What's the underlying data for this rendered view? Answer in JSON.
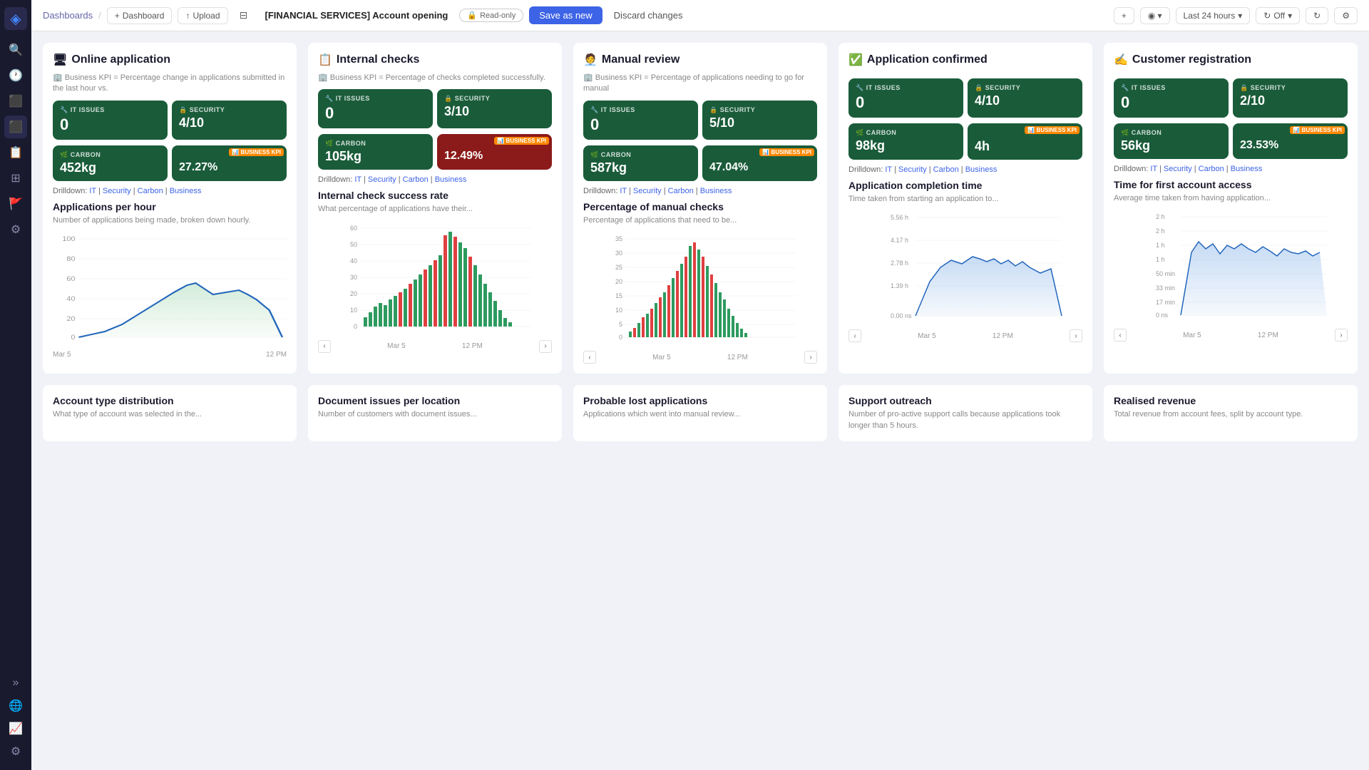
{
  "sidebar": {
    "icons": [
      {
        "name": "logo-icon",
        "symbol": "◈"
      },
      {
        "name": "search-icon",
        "symbol": "🔍"
      },
      {
        "name": "recent-icon",
        "symbol": "🕐"
      },
      {
        "name": "apps-icon",
        "symbol": "⬛"
      },
      {
        "name": "layers-icon",
        "symbol": "📊"
      },
      {
        "name": "panel-icon",
        "symbol": "📋"
      },
      {
        "name": "grid-icon",
        "symbol": "⊞"
      },
      {
        "name": "flag-icon",
        "symbol": "🚩"
      },
      {
        "name": "code-icon",
        "symbol": "⚙"
      },
      {
        "name": "bottom-expand-icon",
        "symbol": "»"
      },
      {
        "name": "globe-icon",
        "symbol": "🌐"
      },
      {
        "name": "chart-icon",
        "symbol": "📈"
      },
      {
        "name": "settings-icon",
        "symbol": "⚙"
      }
    ]
  },
  "topnav": {
    "dashboards_label": "Dashboards",
    "dashboard_label": "Dashboard",
    "upload_label": "Upload",
    "breadcrumb_label": "[FINANCIAL SERVICES] Account opening",
    "read_only_label": "Read-only",
    "save_as_new_label": "Save as new",
    "discard_changes_label": "Discard changes",
    "add_icon": "+",
    "view_icon": "◉",
    "time_range": "Last 24 hours",
    "auto_refresh": "Off",
    "refresh_icon": "↻",
    "settings_icon": "⚙"
  },
  "columns": [
    {
      "id": "online-application",
      "icon": "🖥",
      "title": "Online application",
      "subtitle": "🏢 Business KPI = Percentage change in applications submitted in the last hour vs.",
      "it_issues": "0",
      "security": "4/10",
      "carbon": "452kg",
      "business_kpi": "27.27%",
      "business_kpi_red": false,
      "kpi_red": false,
      "chart_title": "Applications per hour",
      "chart_desc": "Number of applications being made, broken down hourly.",
      "chart_type": "line",
      "chart_y_max": 100,
      "chart_y_labels": [
        "100",
        "80",
        "60",
        "40",
        "20",
        "0"
      ],
      "chart_x_labels": [
        "Mar 5",
        "12 PM"
      ],
      "drilldown": {
        "it": "IT",
        "security": "Security",
        "carbon": "Carbon",
        "business": "Business"
      }
    },
    {
      "id": "internal-checks",
      "icon": "📋",
      "title": "Internal checks",
      "subtitle": "🏢 Business KPI = Percentage of checks completed successfully.",
      "it_issues": "0",
      "security": "3/10",
      "carbon": "105kg",
      "business_kpi": "12.49%",
      "business_kpi_red": true,
      "kpi_red": false,
      "chart_title": "Internal check success rate",
      "chart_desc": "What percentage of applications have their...",
      "chart_type": "bar",
      "chart_y_max": 60,
      "chart_y_labels": [
        "60",
        "50",
        "40",
        "30",
        "20",
        "10",
        "0"
      ],
      "chart_x_labels": [
        "Mar 5",
        "12 PM"
      ],
      "drilldown": {
        "it": "IT",
        "security": "Security",
        "carbon": "Carbon",
        "business": "Business"
      }
    },
    {
      "id": "manual-review",
      "icon": "🧑‍💼",
      "title": "Manual review",
      "subtitle": "🏢 Business KPI = Percentage of applications needing to go for manual",
      "it_issues": "0",
      "security": "5/10",
      "carbon": "587kg",
      "business_kpi": "47.04%",
      "business_kpi_red": false,
      "kpi_red": false,
      "chart_title": "Percentage of manual checks",
      "chart_desc": "Percentage of applications that need to be...",
      "chart_type": "bar",
      "chart_y_max": 35,
      "chart_y_labels": [
        "35",
        "30",
        "25",
        "20",
        "15",
        "10",
        "5",
        "0"
      ],
      "chart_x_labels": [
        "Mar 5",
        "12 PM"
      ],
      "drilldown": {
        "it": "IT",
        "security": "Security",
        "carbon": "Carbon",
        "business": "Business"
      }
    },
    {
      "id": "application-confirmed",
      "icon": "✅",
      "title": "Application confirmed",
      "subtitle": "",
      "it_issues": "0",
      "security": "4/10",
      "carbon": "98kg",
      "business_kpi": "4h",
      "business_kpi_red": false,
      "kpi_red": false,
      "chart_title": "Application completion time",
      "chart_desc": "Time taken from starting an application to...",
      "chart_type": "line",
      "chart_y_max": 5.56,
      "chart_y_labels": [
        "5.56 h",
        "4.17 h",
        "2.78 h",
        "1.39 h",
        "0.00 ns"
      ],
      "chart_x_labels": [
        "Mar 5",
        "12 PM"
      ],
      "drilldown": {
        "it": "IT",
        "security": "Security",
        "carbon": "Carbon",
        "business": "Business"
      }
    },
    {
      "id": "customer-registration",
      "icon": "✍",
      "title": "Customer registration",
      "subtitle": "",
      "it_issues": "0",
      "security": "2/10",
      "carbon": "56kg",
      "business_kpi": "23.53%",
      "business_kpi_red": false,
      "kpi_red": false,
      "chart_title": "Time for first account access",
      "chart_desc": "Average time taken from having application...",
      "chart_type": "line",
      "chart_y_max": "2h",
      "chart_y_labels": [
        "2 h",
        "2 h",
        "1 h",
        "1 h",
        "50 min",
        "33 min",
        "17 min",
        "0 ns"
      ],
      "chart_x_labels": [
        "Mar 5",
        "12 PM"
      ],
      "drilldown": {
        "it": "IT",
        "security": "Security",
        "carbon": "Carbon",
        "business": "Business"
      }
    }
  ],
  "bottom_cards": [
    {
      "id": "account-type",
      "title": "Account type distribution",
      "desc": "What type of account was selected in the..."
    },
    {
      "id": "document-issues",
      "title": "Document issues per location",
      "desc": "Number of customers with document issues..."
    },
    {
      "id": "probable-lost",
      "title": "Probable lost applications",
      "desc": "Applications which went into manual review..."
    },
    {
      "id": "support-outreach",
      "title": "Support outreach",
      "desc": "Number of pro-active support calls because applications took longer than 5 hours."
    },
    {
      "id": "realised-revenue",
      "title": "Realised revenue",
      "desc": "Total revenue from account fees, split by account type."
    }
  ],
  "colors": {
    "green_dark": "#1a5c3a",
    "red_kpi": "#8b1a1a",
    "blue_accent": "#3d63e6",
    "sidebar_bg": "#1a1a2e"
  }
}
